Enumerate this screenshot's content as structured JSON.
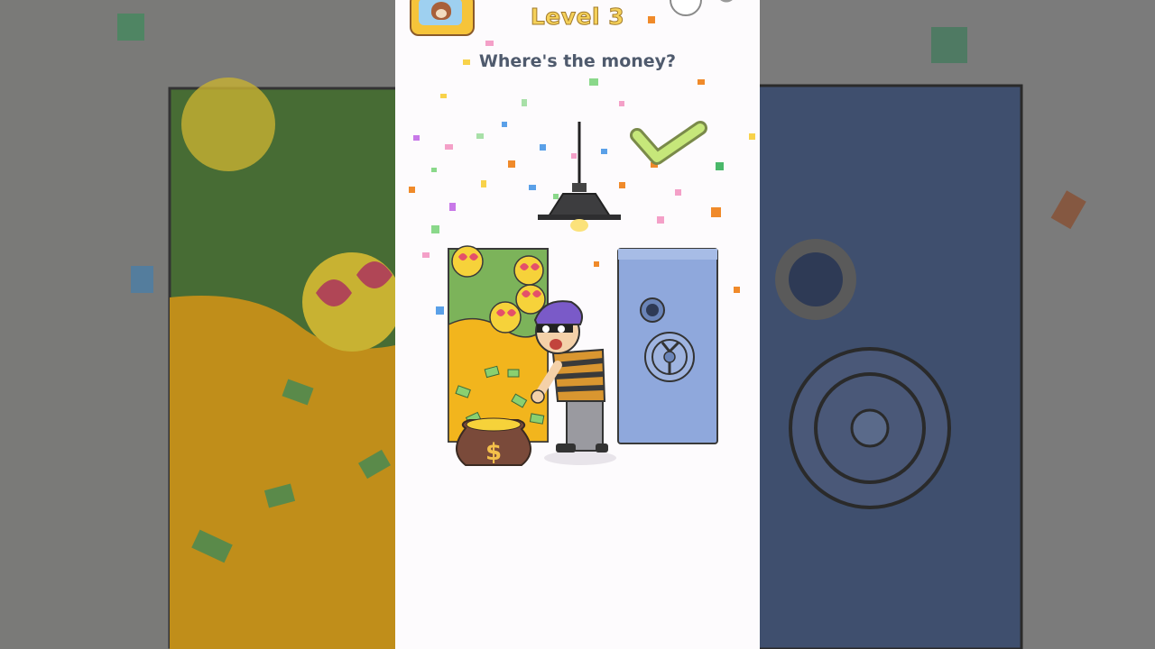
{
  "header": {
    "level_label": "Level 3",
    "avatar_icon": "dog-avatar-icon",
    "top_right_icons": [
      "abc-hint-icon",
      "gear-icon"
    ]
  },
  "puzzle": {
    "question": "Where's the money?",
    "status": "solved",
    "feedback_icon": "checkmark-icon"
  },
  "colors": {
    "level_text": "#f5d15a",
    "question_text": "#4f5a6d",
    "check_green": "#c6e77a",
    "safe_blue": "#8fa8dc",
    "gold": "#f2b51d",
    "money_green": "#7cb35a"
  }
}
